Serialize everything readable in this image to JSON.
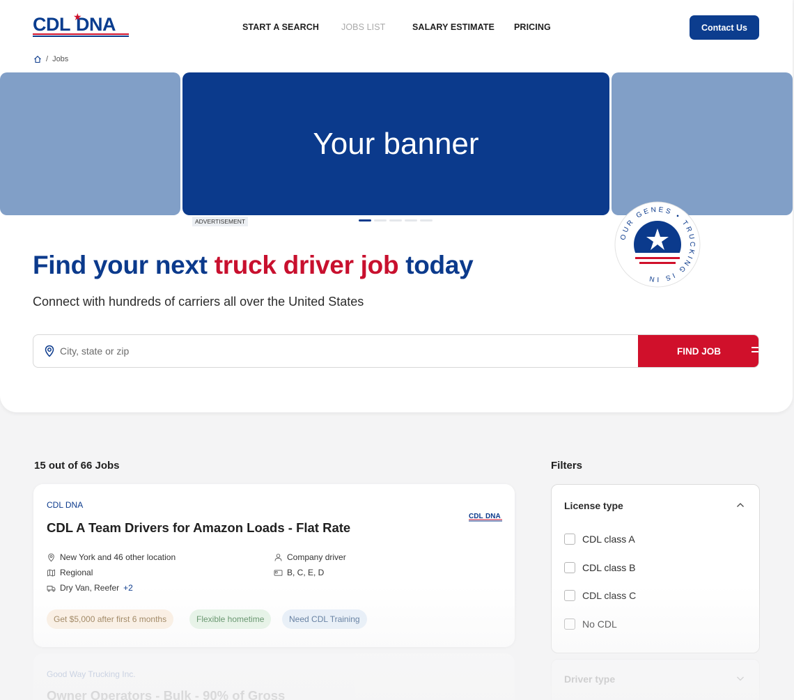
{
  "brand": {
    "logo_cdl": "CDL",
    "logo_dna": "DNA",
    "red": "#d0102b",
    "blue": "#0b3a8c"
  },
  "nav": {
    "items": [
      {
        "label": "START A SEARCH"
      },
      {
        "label": "JOBS LIST",
        "disabled": true
      },
      {
        "label": "SALARY ESTIMATE"
      },
      {
        "label": "PRICING"
      }
    ],
    "contact_label": "Contact Us"
  },
  "breadcrumb": {
    "home_icon": "home-icon",
    "separator": "/",
    "current": "Jobs"
  },
  "banner": {
    "main_text": "Your banner",
    "ad_label": "ADVERTISEMENT",
    "slide_count": 5,
    "active_slide": 1
  },
  "badge": {
    "ring_text": "OUR GENES • TRUCKING IS IN",
    "icon": "star-icon"
  },
  "hero": {
    "title_part1": "Find your next ",
    "title_accent": "truck driver job",
    "title_part2": " today",
    "subtitle": "Connect with hundreds of carriers all over the United States"
  },
  "search": {
    "placeholder": "City, state or zip",
    "button_label": "FIND JOB",
    "pin_icon": "location-pin-icon"
  },
  "results": {
    "count_label": "15 out of 66 Jobs"
  },
  "jobs": [
    {
      "company": "CDL DNA",
      "title": "CDL A Team Drivers for Amazon Loads - Flat Rate",
      "location": "New York and 46 other location",
      "route": "Regional",
      "trailer": "Dry Van, Reefer",
      "trailer_more": "+2",
      "driver_type": "Company driver",
      "license": "B, C, E, D",
      "tags": [
        {
          "label": "Get $5,000 after first 6 months",
          "bg": "#fbeee0",
          "fg": "#8a6a3d"
        },
        {
          "label": "Flexible hometime",
          "bg": "#e3f3e4",
          "fg": "#3f7a48"
        },
        {
          "label": "Need CDL Training",
          "bg": "#e5eef8",
          "fg": "#3d5f8a"
        }
      ]
    },
    {
      "company": "Good Way Trucking Inc.",
      "title": "Owner Operators - Bulk - 90% of Gross"
    }
  ],
  "filters": {
    "title": "Filters",
    "license": {
      "title": "License type",
      "options": [
        "CDL class A",
        "CDL class B",
        "CDL class C",
        "No CDL"
      ]
    },
    "driver": {
      "title": "Driver type"
    }
  }
}
